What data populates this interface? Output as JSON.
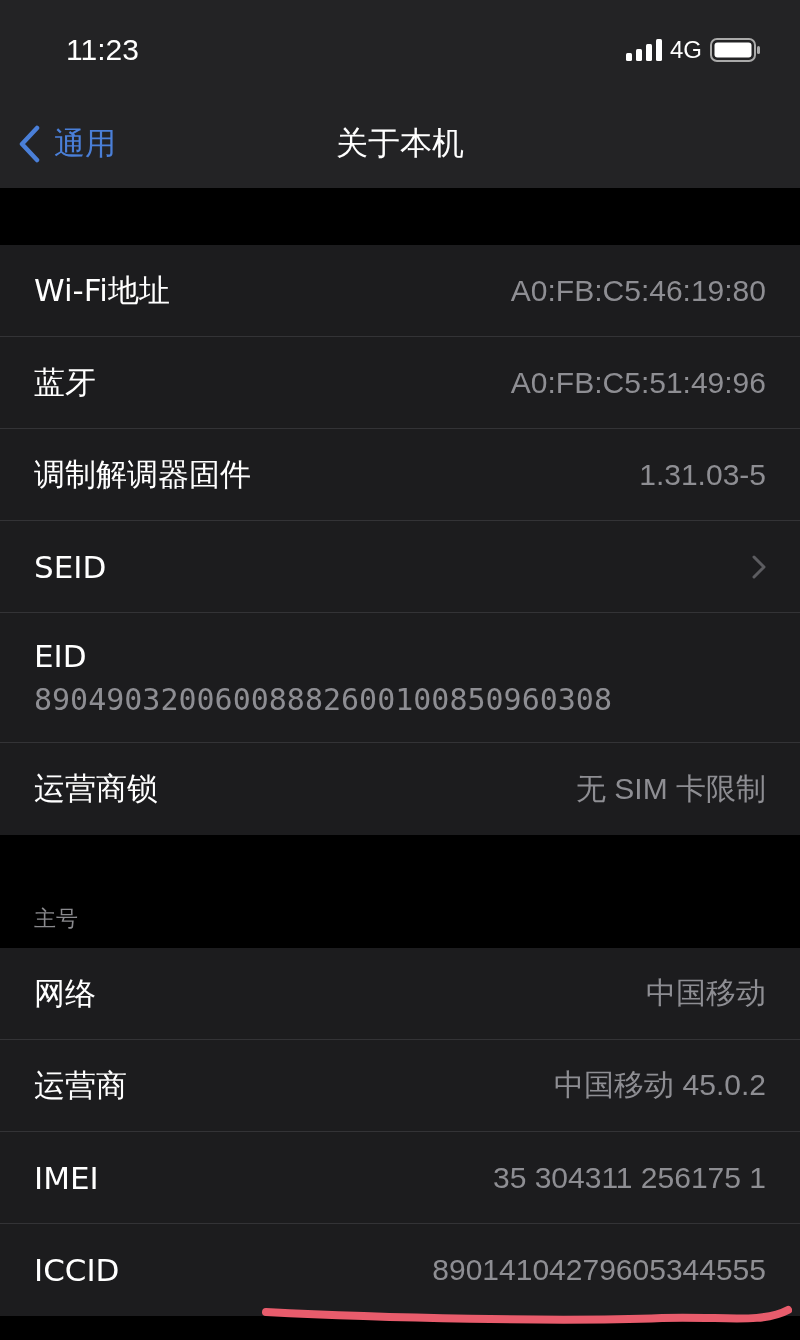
{
  "status_bar": {
    "time": "11:23",
    "network": "4G"
  },
  "nav": {
    "back": "通用",
    "title": "关于本机"
  },
  "sections": [
    {
      "rows": [
        {
          "kind": "value",
          "label": "Wi-Fi地址",
          "value": "A0:FB:C5:46:19:80",
          "underlined": false
        },
        {
          "kind": "value",
          "label": "蓝牙",
          "value": "A0:FB:C5:51:49:96",
          "underlined": false
        },
        {
          "kind": "value",
          "label": "调制解调器固件",
          "value": "1.31.03-5",
          "underlined": false
        },
        {
          "kind": "link",
          "label": "SEID",
          "underlined": false
        },
        {
          "kind": "stacked",
          "label": "EID",
          "value": "89049032006008882600100850960308",
          "underlined": false
        },
        {
          "kind": "value",
          "label": "运营商锁",
          "value": "无 SIM 卡限制",
          "underlined": false
        }
      ]
    },
    {
      "header": "主号",
      "rows": [
        {
          "kind": "value",
          "label": "网络",
          "value": "中国移动",
          "underlined": false
        },
        {
          "kind": "value",
          "label": "运营商",
          "value": "中国移动 45.0.2",
          "underlined": false
        },
        {
          "kind": "value",
          "label": "IMEI",
          "value": "35 304311 256175 1",
          "underlined": false
        },
        {
          "kind": "value",
          "label": "ICCID",
          "value": "89014104279605344555",
          "underlined": true
        }
      ]
    }
  ]
}
